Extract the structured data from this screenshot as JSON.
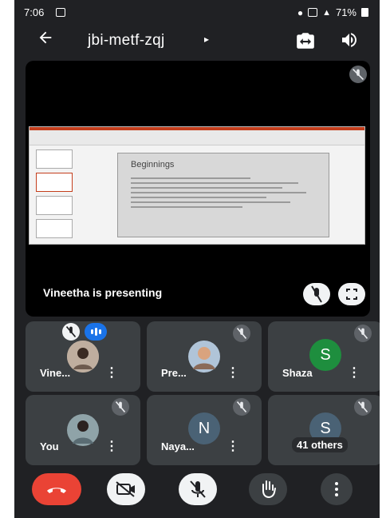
{
  "status_bar": {
    "time": "7:06",
    "battery": "71%"
  },
  "header": {
    "meeting_code": "jbi-metf-zqj"
  },
  "presentation": {
    "label": "Vineetha is presenting",
    "slide_title": "Beginnings"
  },
  "participants": [
    {
      "name": "Vine...",
      "avatar": "photo"
    },
    {
      "name": "Pre...",
      "avatar": "photo"
    },
    {
      "name": "Shaza",
      "avatar": "letter",
      "letter": "S",
      "color": "#1e8e3e"
    },
    {
      "name": "You",
      "avatar": "photo"
    },
    {
      "name": "Naya...",
      "avatar": "letter",
      "letter": "N",
      "color": "#4a6275"
    },
    {
      "name": "41 others",
      "avatar": "letter",
      "letter": "S",
      "color": "#4a6275"
    }
  ],
  "colors": {
    "background": "#202124",
    "tile": "#3c4043",
    "end_call": "#ea4335",
    "speaking": "#1a73e8"
  },
  "icons": [
    "back-arrow-icon",
    "dropdown-caret-icon",
    "switch-camera-icon",
    "speaker-icon",
    "mic-off-icon",
    "fullscreen-icon",
    "more-vert-icon",
    "end-call-icon",
    "camera-off-icon",
    "raise-hand-icon",
    "speaking-indicator-icon"
  ]
}
